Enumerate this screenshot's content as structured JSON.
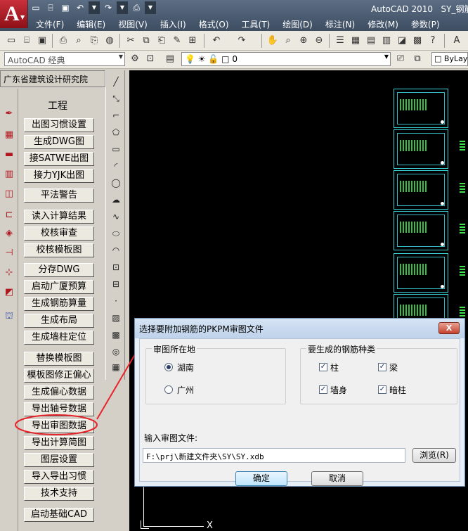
{
  "titlebar": {
    "app_title": "AutoCAD 2010",
    "doc_title": "SY_钢筋",
    "menus": [
      "文件(F)",
      "编辑(E)",
      "视图(V)",
      "插入(I)",
      "格式(O)",
      "工具(T)",
      "绘图(D)",
      "标注(N)",
      "修改(M)",
      "参数(P)"
    ]
  },
  "toolbar2": {
    "workspace": "AutoCAD 经典",
    "layer_value": "0",
    "linetype": "ByLay"
  },
  "left_panel": {
    "header": "广东省建筑设计研究院",
    "title": "工程",
    "buttons": [
      "出图习惯设置",
      "生成DWG图",
      "接SATWE出图",
      "接力YJK出图",
      "平法警告",
      "读入计算结果",
      "校核审查",
      "校核模板图",
      "分存DWG",
      "启动广厦预算",
      "生成钢筋算量",
      "生成布局",
      "生成墙柱定位",
      "替换模板图",
      "模板图修正偏心",
      "生成偏心数据",
      "导出轴号数据",
      "导出审图数据",
      "导出计算简图",
      "图层设置",
      "导入导出习惯",
      "技术支持",
      "启动基础CAD"
    ]
  },
  "canvas": {
    "ucs_x": "X"
  },
  "dialog": {
    "title": "选择要附加钢筋的PKPM审图文件",
    "close_label": "X",
    "region_group": "审图所在地",
    "region_options": [
      "湖南",
      "广州"
    ],
    "selected_region": "湖南",
    "rebar_group": "要生成的钢筋种类",
    "rebar_types": [
      "柱",
      "梁",
      "墙身",
      "暗柱"
    ],
    "rebar_checked": [
      "柱",
      "梁",
      "墙身",
      "暗柱"
    ],
    "file_label": "输入审图文件:",
    "file_path": "F:\\prj\\新建文件夹\\SY\\SY.xdb",
    "browse_label": "浏览(R)",
    "ok_label": "确定",
    "cancel_label": "取消"
  },
  "colors": {
    "highlight": "#e8232a",
    "canvas_bg": "#000000",
    "sheet_border": "#3ad0d8",
    "rebar_green": "#3fe04a"
  }
}
